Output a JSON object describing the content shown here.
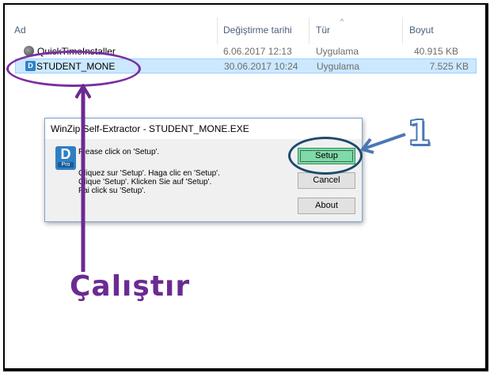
{
  "explorer": {
    "columns": {
      "name": "Ad",
      "date": "Değiştirme tarihi",
      "type": "Tür",
      "size": "Boyut"
    },
    "files": [
      {
        "name": "QuickTimeInstaller",
        "date": "6.06.2017 12:13",
        "type": "Uygulama",
        "size": "40.915 KB",
        "icon": "quicktime-icon"
      },
      {
        "name": "STUDENT_MONE",
        "date": "30.06.2017 10:24",
        "type": "Uygulama",
        "size": "7.525 KB",
        "icon": "app-icon",
        "selected": true
      }
    ]
  },
  "dialog": {
    "title": "WinZip Self-Extractor - STUDENT_MONE.EXE",
    "icon_letter": "D",
    "icon_badge": "Pro",
    "messages": [
      "Please click on 'Setup'.",
      "Cliquez sur 'Setup'.  Haga clic en 'Setup'.",
      "Clique 'Setup'.  Klicken Sie auf 'Setup'.",
      "Fai click su 'Setup'."
    ],
    "buttons": {
      "setup": "Setup",
      "cancel": "Cancel",
      "about": "About"
    }
  },
  "annotations": {
    "step_number": "1",
    "run_label": "Çalıştır",
    "purple": "#6b2a92",
    "blue": "#4a78b5"
  }
}
